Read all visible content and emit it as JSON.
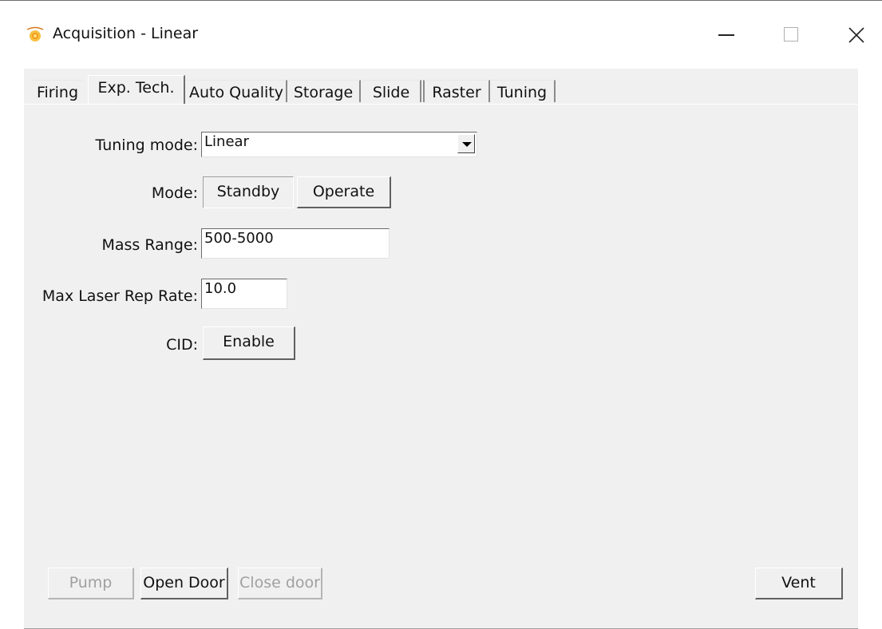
{
  "window": {
    "title": "Acquisition - Linear",
    "icon": "acquisition-app-icon"
  },
  "tabs": [
    {
      "label": "Firing"
    },
    {
      "label": "Exp. Tech.",
      "active": true
    },
    {
      "label": "Auto Quality"
    },
    {
      "label": "Storage"
    },
    {
      "label": "Slide"
    },
    {
      "label": "Raster"
    },
    {
      "label": "Tuning"
    }
  ],
  "form": {
    "tuning_mode": {
      "label": "Tuning mode:",
      "value": "Linear"
    },
    "mode": {
      "label": "Mode:",
      "standby_label": "Standby",
      "operate_label": "Operate"
    },
    "mass_range": {
      "label": "Mass Range:",
      "value": "500-5000"
    },
    "max_laser_rep_rate": {
      "label": "Max Laser Rep Rate:",
      "value": "10.0"
    },
    "cid": {
      "label": "CID:",
      "button_label": "Enable"
    }
  },
  "footer": {
    "pump_label": "Pump",
    "open_door_label": "Open Door",
    "close_door_label": "Close door",
    "vent_label": "Vent"
  },
  "colors": {
    "panel_bg": "#f0f0f0",
    "disabled_text": "#a0a0a0"
  }
}
